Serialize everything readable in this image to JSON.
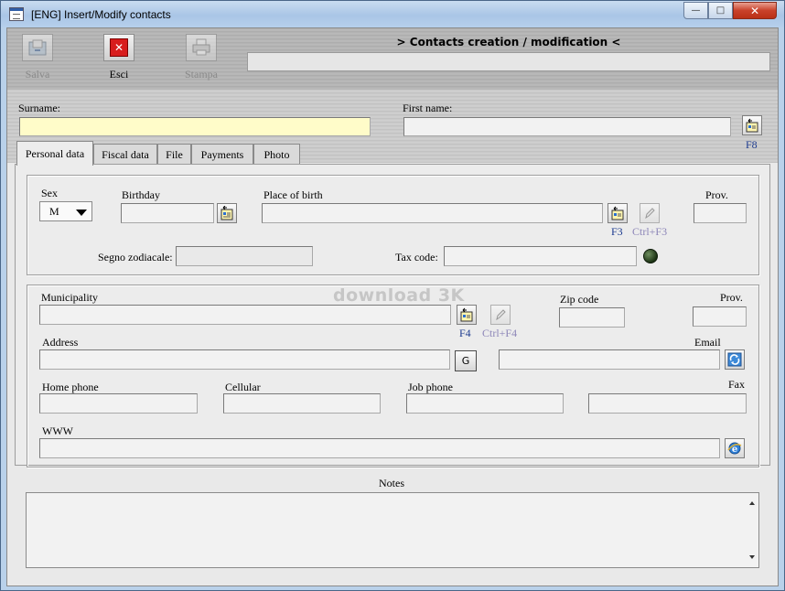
{
  "window": {
    "title": "[ENG] Insert/Modify contacts"
  },
  "toolbar": {
    "save_label": "Salva",
    "exit_label": "Esci",
    "print_label": "Stampa"
  },
  "header": {
    "title": "> Contacts creation / modification <"
  },
  "names": {
    "surname_label": "Surname:",
    "surname_value": "",
    "firstname_label": "First name:",
    "firstname_value": "",
    "lookup_key": "F8"
  },
  "tabs": [
    "Personal data",
    "Fiscal data",
    "File",
    "Payments",
    "Photo"
  ],
  "personal": {
    "sex_label": "Sex",
    "sex_value": "M",
    "birthday_label": "Birthday",
    "place_label": "Place of birth",
    "place_key": "F3",
    "place_edit_key": "Ctrl+F3",
    "prov_label": "Prov.",
    "zodiac_label": "Segno zodiacale:",
    "taxcode_label": "Tax code:"
  },
  "address": {
    "municipality_label": "Municipality",
    "muni_key": "F4",
    "muni_edit_key": "Ctrl+F4",
    "zip_label": "Zip code",
    "prov_label": "Prov.",
    "address_label": "Address",
    "g_button": "G",
    "email_label": "Email",
    "home_phone_label": "Home phone",
    "cellular_label": "Cellular",
    "job_phone_label": "Job phone",
    "fax_label": "Fax",
    "www_label": "WWW"
  },
  "notes": {
    "label": "Notes",
    "value": ""
  },
  "watermark": "download 3k",
  "colors": {
    "required_field": "#fffcc9",
    "close_red": "#d81d1d",
    "key_blue": "#1d3b8f"
  }
}
